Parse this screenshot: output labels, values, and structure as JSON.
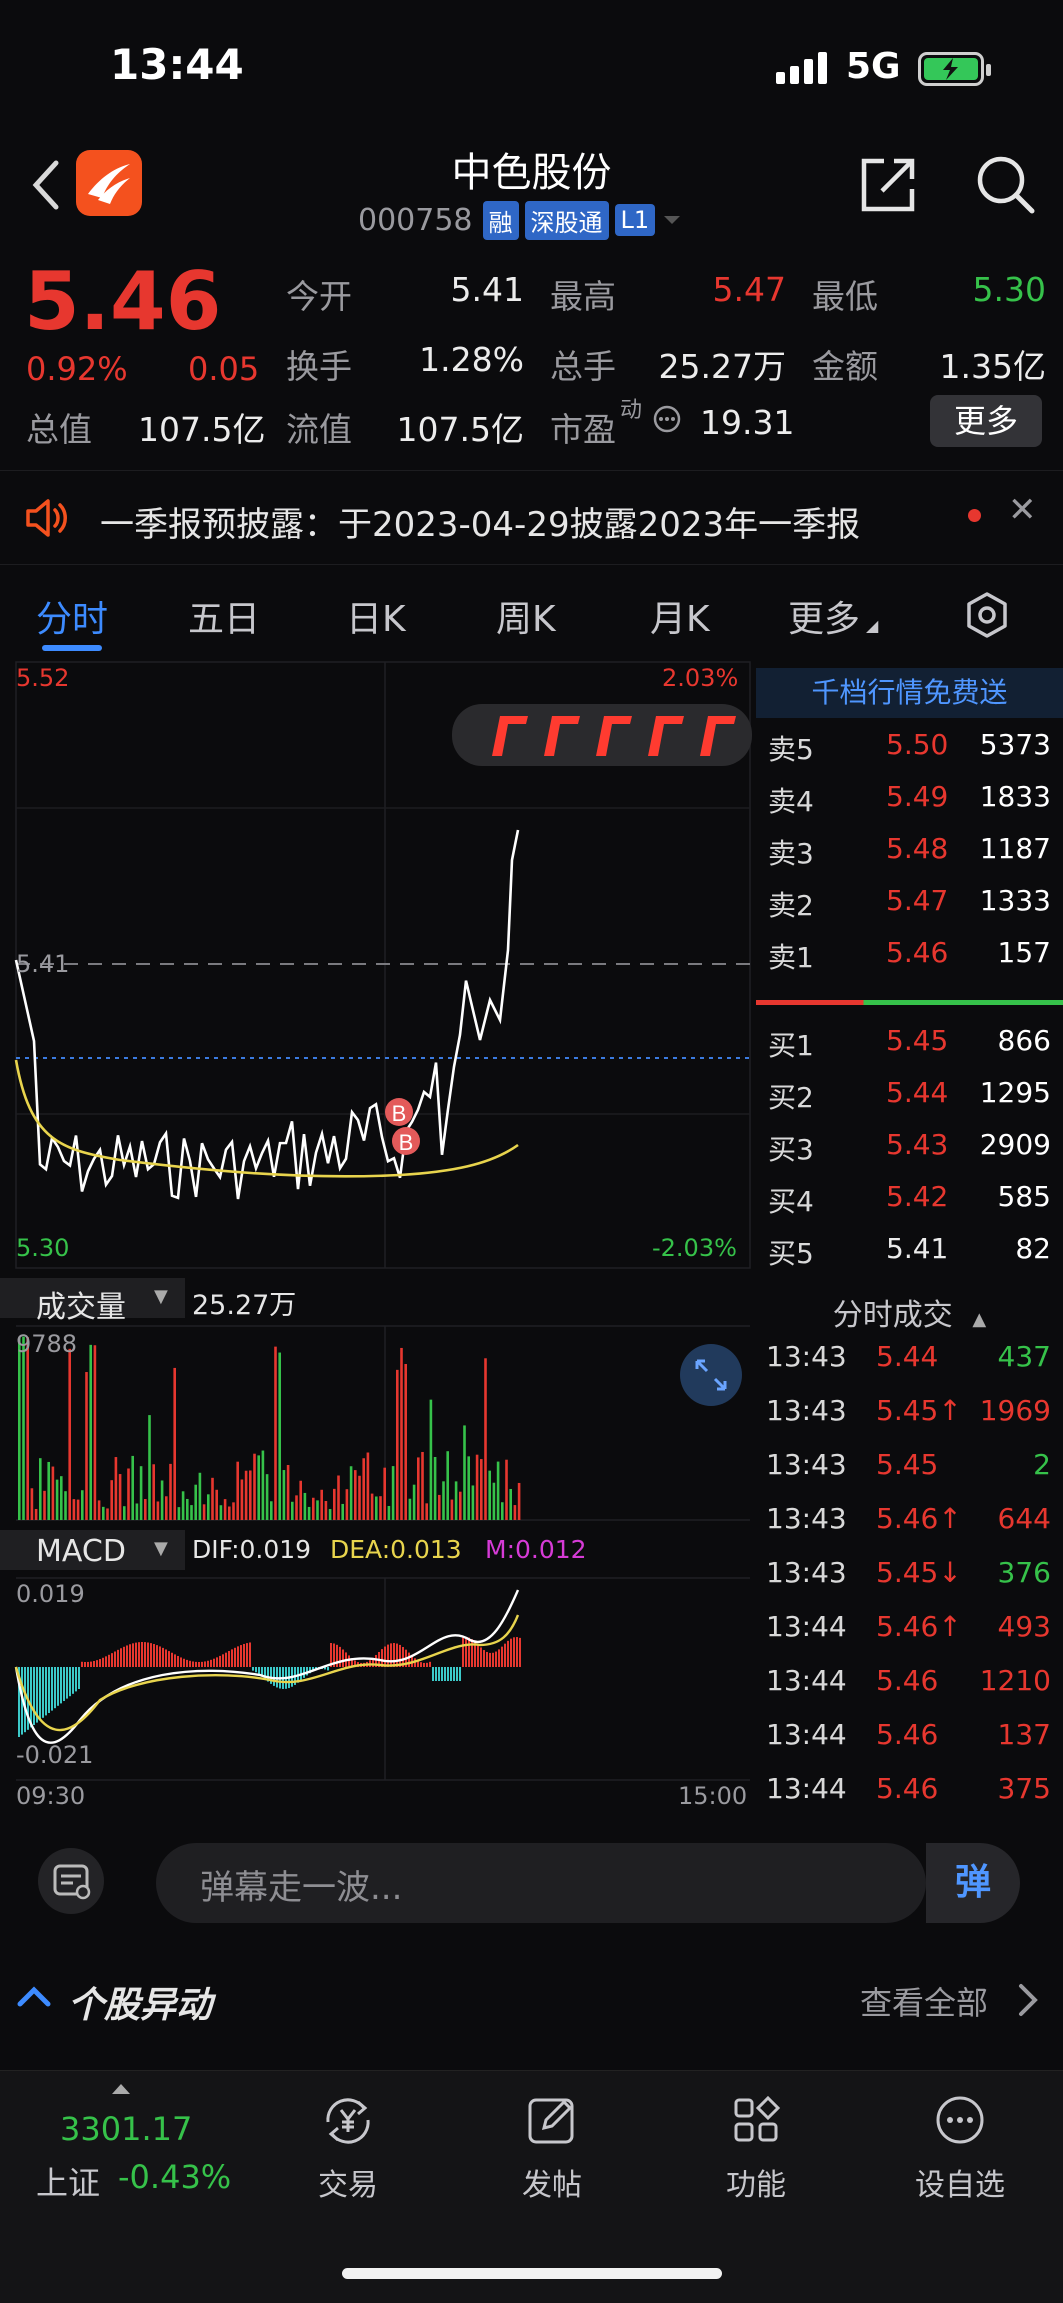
{
  "status": {
    "time": "13:44",
    "network": "5G"
  },
  "header": {
    "name": "中色股份",
    "code": "000758",
    "tags": [
      "融",
      "深股通",
      "L1"
    ]
  },
  "quote": {
    "price": "5.46",
    "change_pct": "0.92%",
    "change_amt": "0.05",
    "open_label": "今开",
    "open": "5.41",
    "high_label": "最高",
    "high": "5.47",
    "low_label": "最低",
    "low": "5.30",
    "turnover_label": "换手",
    "turnover": "1.28%",
    "volume_label": "总手",
    "volume": "25.27万",
    "amount_label": "金额",
    "amount": "1.35亿",
    "mktcap_label": "总值",
    "mktcap": "107.5亿",
    "float_label": "流值",
    "float": "107.5亿",
    "pe_label": "市盈",
    "pe_sup": "动",
    "pe": "19.31",
    "more_label": "更多"
  },
  "notice": {
    "text": "一季报预披露：于2023-04-29披露2023年一季报"
  },
  "tabs": [
    "分时",
    "五日",
    "日K",
    "周K",
    "月K",
    "更多"
  ],
  "chart": {
    "price_top": "5.52",
    "pct_top": "2.03%",
    "price_mid": "5.41",
    "price_bottom": "5.30",
    "pct_bottom": "-2.03%",
    "marker": "B",
    "volume_label": "成交量",
    "volume_value": "25.27万",
    "volume_max": "9788",
    "macd_label": "MACD",
    "dif": "DIF:0.019",
    "dea": "DEA:0.013",
    "m": "M:0.012",
    "macd_top": "0.019",
    "macd_bottom": "-0.021",
    "time_start": "09:30",
    "time_end": "15:00",
    "colors": {
      "up": "#e7372f",
      "down": "#36c24a",
      "price_line": "#ffffff",
      "avg_line": "#e8d44d",
      "dea_line": "#e8d44d",
      "m_color": "#d63bd6",
      "cyan": "#3cc9c9"
    }
  },
  "orderbook": {
    "banner": "千档行情免费送",
    "asks": [
      {
        "label": "卖5",
        "price": "5.50",
        "vol": "5373"
      },
      {
        "label": "卖4",
        "price": "5.49",
        "vol": "1833"
      },
      {
        "label": "卖3",
        "price": "5.48",
        "vol": "1187"
      },
      {
        "label": "卖2",
        "price": "5.47",
        "vol": "1333"
      },
      {
        "label": "卖1",
        "price": "5.46",
        "vol": "157"
      }
    ],
    "bids": [
      {
        "label": "买1",
        "price": "5.45",
        "vol": "866"
      },
      {
        "label": "买2",
        "price": "5.44",
        "vol": "1295"
      },
      {
        "label": "买3",
        "price": "5.43",
        "vol": "2909"
      },
      {
        "label": "买4",
        "price": "5.42",
        "vol": "585"
      },
      {
        "label": "买5",
        "price": "5.41",
        "vol": "82"
      }
    ]
  },
  "trades": {
    "title": "分时成交",
    "rows": [
      {
        "time": "13:43",
        "price": "5.44",
        "vol": "437",
        "vol_color": "green"
      },
      {
        "time": "13:43",
        "price": "5.45↑",
        "vol": "1969",
        "vol_color": "red"
      },
      {
        "time": "13:43",
        "price": "5.45",
        "vol": "2",
        "vol_color": "green"
      },
      {
        "time": "13:43",
        "price": "5.46↑",
        "vol": "644",
        "vol_color": "red"
      },
      {
        "time": "13:43",
        "price": "5.45↓",
        "vol": "376",
        "vol_color": "green"
      },
      {
        "time": "13:44",
        "price": "5.46↑",
        "vol": "493",
        "vol_color": "red"
      },
      {
        "time": "13:44",
        "price": "5.46",
        "vol": "1210",
        "vol_color": "red"
      },
      {
        "time": "13:44",
        "price": "5.46",
        "vol": "137",
        "vol_color": "red"
      },
      {
        "time": "13:44",
        "price": "5.46",
        "vol": "375",
        "vol_color": "red"
      }
    ]
  },
  "danmu": {
    "placeholder": "弹幕走一波...",
    "send": "弹"
  },
  "section": {
    "title": "个股异动",
    "more": "查看全部"
  },
  "bottom": {
    "index_value": "3301.17",
    "index_name": "上证",
    "index_change": "-0.43%",
    "items": [
      {
        "label": "交易",
        "icon": "yen-exchange-icon"
      },
      {
        "label": "发帖",
        "icon": "edit-icon"
      },
      {
        "label": "功能",
        "icon": "grid-icon"
      },
      {
        "label": "设自选",
        "icon": "more-dots-icon"
      }
    ]
  }
}
